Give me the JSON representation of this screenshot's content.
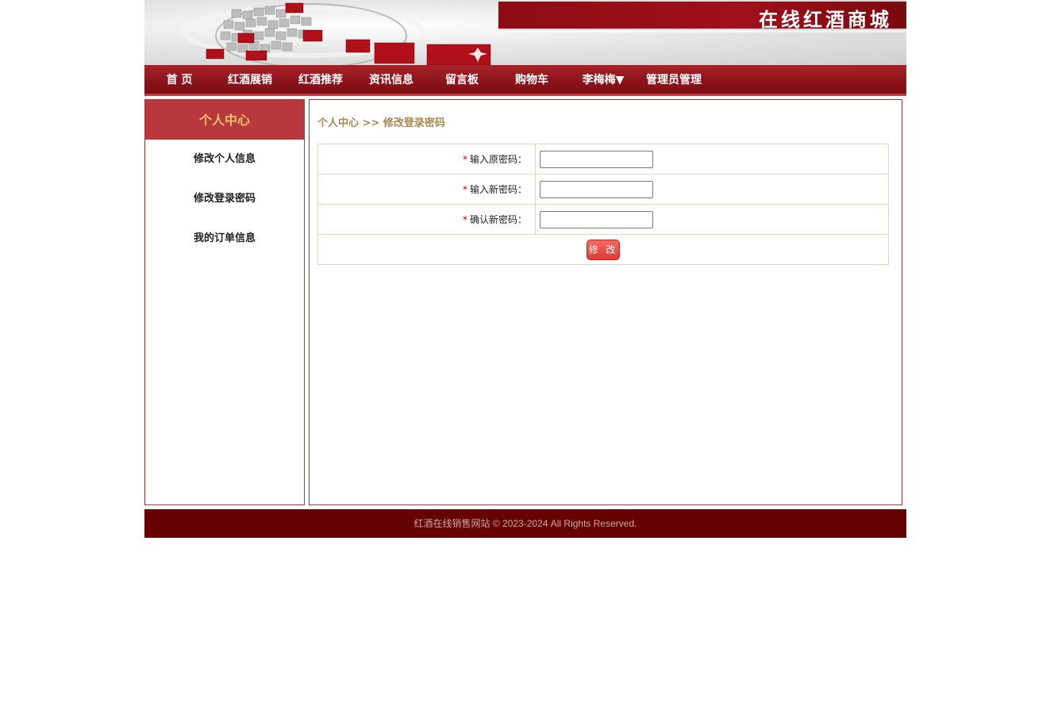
{
  "header": {
    "site_title": "在线红酒商城"
  },
  "nav": {
    "items": [
      {
        "label": "首 页"
      },
      {
        "label": "红酒展销"
      },
      {
        "label": "红酒推荐"
      },
      {
        "label": "资讯信息"
      },
      {
        "label": "留言板"
      },
      {
        "label": "购物车"
      },
      {
        "label": "李梅梅▼"
      },
      {
        "label": "管理员管理"
      }
    ]
  },
  "sidebar": {
    "title": "个人中心",
    "items": [
      {
        "label": "修改个人信息"
      },
      {
        "label": "修改登录密码"
      },
      {
        "label": "我的订单信息"
      }
    ]
  },
  "main": {
    "breadcrumb": "个人中心 >> 修改登录密码",
    "form": {
      "required_mark": "*",
      "fields": [
        {
          "label": "输入原密码：",
          "value": ""
        },
        {
          "label": "输入新密码：",
          "value": ""
        },
        {
          "label": "确认新密码：",
          "value": ""
        }
      ],
      "submit_label": "修 改"
    }
  },
  "footer": {
    "text": "红酒在线销售网站  © 2023-2024 All Rights Reserved."
  },
  "colors": {
    "brand_red": "#8d141b",
    "footer_bg": "#660000",
    "sidebar_head": "#b8383b",
    "breadcrumb": "#a88a52"
  }
}
